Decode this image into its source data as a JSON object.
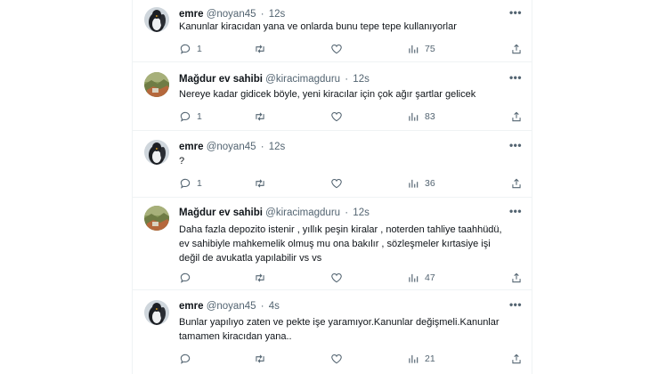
{
  "tweets": [
    {
      "author": "emre",
      "handle": "@noyan45",
      "dot": "·",
      "time": "12s",
      "avatar": "penguin-avatar",
      "lines": [
        "Kanunlar kiracıdan yana ve onlarda bunu tepe tepe kullanıyorlar"
      ],
      "replies": "1",
      "retweets": "",
      "likes": "",
      "views": "75"
    },
    {
      "author": "Mağdur ev sahibi",
      "handle": "@kiracimagduru",
      "dot": "·",
      "time": "12s",
      "avatar": "landscape-avatar",
      "lines": [
        "Nereye kadar gidicek böyle, yeni kiracılar için çok ağır şartlar gelicek"
      ],
      "replies": "1",
      "retweets": "",
      "likes": "",
      "views": "83"
    },
    {
      "author": "emre",
      "handle": "@noyan45",
      "dot": "·",
      "time": "12s",
      "avatar": "penguin-avatar",
      "lines": [
        "?"
      ],
      "replies": "1",
      "retweets": "",
      "likes": "",
      "views": "36"
    },
    {
      "author": "Mağdur ev sahibi",
      "handle": "@kiracimagduru",
      "dot": "·",
      "time": "12s",
      "avatar": "landscape-avatar",
      "lines": [
        "Daha fazla depozito istenir , yıllık peşin kiralar , noterden tahliye taahhüdü,",
        "ev sahibiyle mahkemelik olmuş mu ona bakılır , sözleşmeler kırtasiye işi",
        "değil de avukatla yapılabilir vs vs"
      ],
      "replies": "",
      "retweets": "",
      "likes": "",
      "views": "47"
    },
    {
      "author": "emre",
      "handle": "@noyan45",
      "dot": "·",
      "time": "4s",
      "avatar": "penguin-avatar",
      "lines": [
        "Bunlar yapılıyo zaten ve pekte işe yaramıyor.Kanunlar değişmeli.Kanunlar",
        "tamamen kiracıdan yana.."
      ],
      "replies": "",
      "retweets": "",
      "likes": "",
      "views": "21"
    }
  ]
}
